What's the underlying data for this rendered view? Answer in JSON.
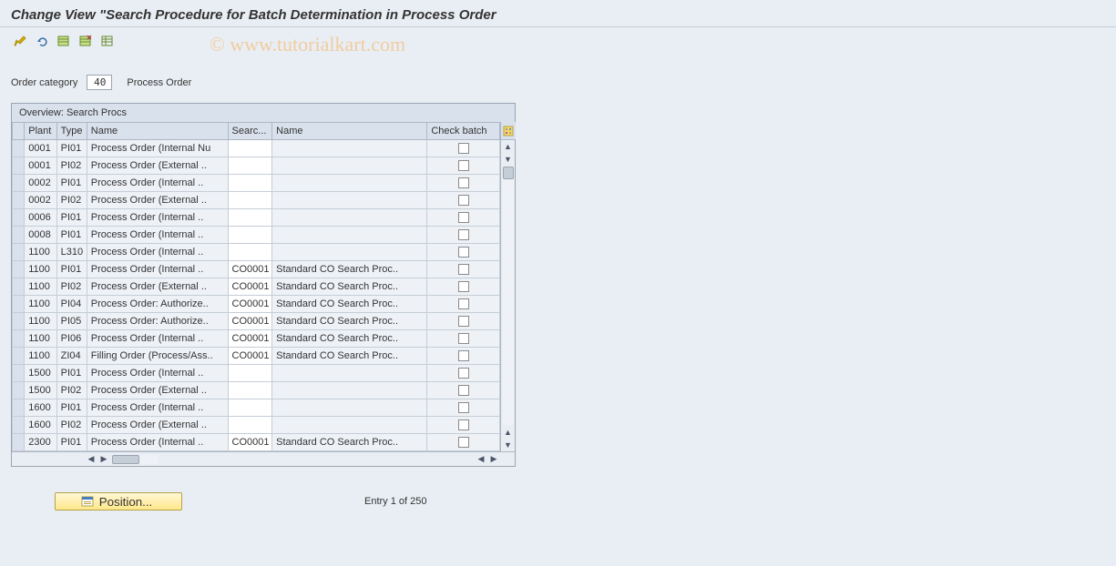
{
  "title": "Change View \"Search Procedure for Batch Determination in Process Order",
  "watermark": "© www.tutorialkart.com",
  "header": {
    "label": "Order category",
    "value": "40",
    "desc": "Process Order"
  },
  "panel_title": "Overview: Search Procs",
  "columns": {
    "plant": "Plant",
    "type": "Type",
    "name": "Name",
    "search": "Searc...",
    "name2": "Name",
    "check": "Check batch"
  },
  "rows": [
    {
      "plant": "0001",
      "type": "PI01",
      "name": "Process Order (Internal Nu",
      "search": "",
      "name2": "",
      "check": false
    },
    {
      "plant": "0001",
      "type": "PI02",
      "name": "Process Order (External ..",
      "search": "",
      "name2": "",
      "check": false
    },
    {
      "plant": "0002",
      "type": "PI01",
      "name": "Process Order (Internal ..",
      "search": "",
      "name2": "",
      "check": false
    },
    {
      "plant": "0002",
      "type": "PI02",
      "name": "Process Order (External ..",
      "search": "",
      "name2": "",
      "check": false
    },
    {
      "plant": "0006",
      "type": "PI01",
      "name": "Process Order (Internal ..",
      "search": "",
      "name2": "",
      "check": false
    },
    {
      "plant": "0008",
      "type": "PI01",
      "name": "Process Order (Internal ..",
      "search": "",
      "name2": "",
      "check": false
    },
    {
      "plant": "1100",
      "type": "L310",
      "name": "Process Order (Internal ..",
      "search": "",
      "name2": "",
      "check": false
    },
    {
      "plant": "1100",
      "type": "PI01",
      "name": "Process Order (Internal ..",
      "search": "CO0001",
      "name2": "Standard CO Search Proc..",
      "check": false
    },
    {
      "plant": "1100",
      "type": "PI02",
      "name": "Process Order (External ..",
      "search": "CO0001",
      "name2": "Standard CO Search Proc..",
      "check": false
    },
    {
      "plant": "1100",
      "type": "PI04",
      "name": "Process Order: Authorize..",
      "search": "CO0001",
      "name2": "Standard CO Search Proc..",
      "check": false
    },
    {
      "plant": "1100",
      "type": "PI05",
      "name": "Process Order: Authorize..",
      "search": "CO0001",
      "name2": "Standard CO Search Proc..",
      "check": false
    },
    {
      "plant": "1100",
      "type": "PI06",
      "name": "Process Order (Internal ..",
      "search": "CO0001",
      "name2": "Standard CO Search Proc..",
      "check": false
    },
    {
      "plant": "1100",
      "type": "ZI04",
      "name": "Filling Order (Process/Ass..",
      "search": "CO0001",
      "name2": "Standard CO Search Proc..",
      "check": false
    },
    {
      "plant": "1500",
      "type": "PI01",
      "name": "Process Order (Internal ..",
      "search": "",
      "name2": "",
      "check": false
    },
    {
      "plant": "1500",
      "type": "PI02",
      "name": "Process Order (External ..",
      "search": "",
      "name2": "",
      "check": false
    },
    {
      "plant": "1600",
      "type": "PI01",
      "name": "Process Order (Internal ..",
      "search": "",
      "name2": "",
      "check": false
    },
    {
      "plant": "1600",
      "type": "PI02",
      "name": "Process Order (External ..",
      "search": "",
      "name2": "",
      "check": false
    },
    {
      "plant": "2300",
      "type": "PI01",
      "name": "Process Order (Internal ..",
      "search": "CO0001",
      "name2": "Standard CO Search Proc..",
      "check": false
    }
  ],
  "footer": {
    "position_label": "Position...",
    "entry_text": "Entry 1 of 250"
  }
}
